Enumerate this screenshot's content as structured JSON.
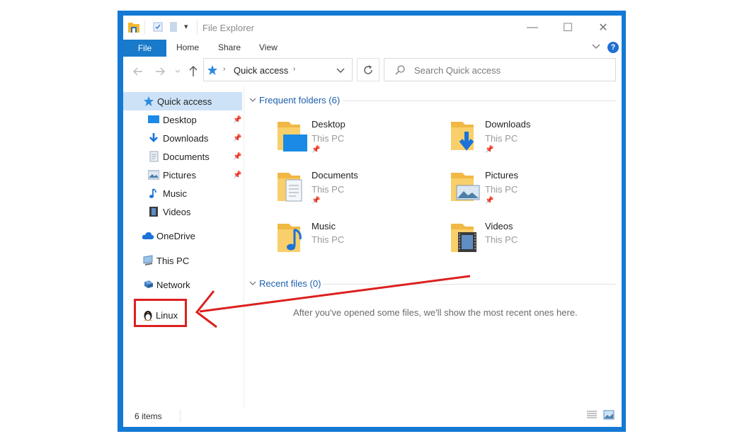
{
  "window": {
    "title": "File Explorer",
    "controls": {
      "minimize": "—",
      "maximize": "☐",
      "close": "✕"
    }
  },
  "ribbon": {
    "tabs": [
      "File",
      "Home",
      "Share",
      "View"
    ],
    "help": "?"
  },
  "address_bar": {
    "path": "Quick access",
    "search_placeholder": "Search Quick access"
  },
  "sidebar": {
    "items": [
      {
        "label": "Quick access",
        "icon": "star-icon",
        "selected": true
      },
      {
        "label": "Desktop",
        "icon": "desktop-icon",
        "pinned": true
      },
      {
        "label": "Downloads",
        "icon": "download-icon",
        "pinned": true
      },
      {
        "label": "Documents",
        "icon": "document-icon",
        "pinned": true
      },
      {
        "label": "Pictures",
        "icon": "pictures-icon",
        "pinned": true
      },
      {
        "label": "Music",
        "icon": "music-icon"
      },
      {
        "label": "Videos",
        "icon": "video-icon"
      },
      {
        "label": "OneDrive",
        "icon": "cloud-icon"
      },
      {
        "label": "This PC",
        "icon": "computer-icon"
      },
      {
        "label": "Network",
        "icon": "network-icon"
      },
      {
        "label": "Linux",
        "icon": "tux-icon",
        "highlighted": true
      }
    ]
  },
  "content": {
    "frequent_header": "Frequent folders (6)",
    "folders": [
      {
        "name": "Desktop",
        "location": "This PC",
        "pinned": true
      },
      {
        "name": "Downloads",
        "location": "This PC",
        "pinned": true
      },
      {
        "name": "Documents",
        "location": "This PC",
        "pinned": true
      },
      {
        "name": "Pictures",
        "location": "This PC",
        "pinned": true
      },
      {
        "name": "Music",
        "location": "This PC",
        "pinned": false
      },
      {
        "name": "Videos",
        "location": "This PC",
        "pinned": false
      }
    ],
    "recent_header": "Recent files (0)",
    "recent_empty": "After you've opened some files, we'll show the most recent ones here."
  },
  "status": {
    "items": "6 items"
  },
  "colors": {
    "accent": "#1479d4",
    "highlight": "#dd1f1f",
    "selection": "#cde2f7",
    "folder": "#f7c753"
  }
}
